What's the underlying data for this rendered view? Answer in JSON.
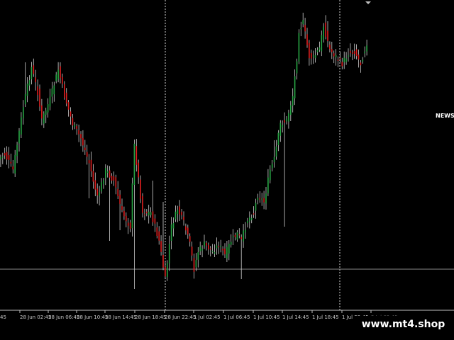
{
  "overlay": {
    "news_label": "NEWS",
    "brand_text": "www.mt4.shop"
  },
  "colors": {
    "background": "#000000",
    "bull_candle": "#28a745",
    "bear_candle": "#e02020",
    "wick": "#d0d0d0",
    "grid_separator": "#cfcfcf",
    "price_line": "#8a8a8a",
    "axis": "#bfbfbf",
    "label": "#c8c8c8"
  },
  "chart_data": {
    "type": "candlestick",
    "title": "",
    "xlabel": "",
    "ylabel": "",
    "x_tick_labels": [
      "28 Jun 02:45",
      "28 Jun 06:45",
      "28 Jun 10:45",
      "28 Jun 14:45",
      "28 Jun 18:45",
      "28 Jun 22:45",
      "1 Jul 02:45",
      "1 Jul 06:45",
      "1 Jul 10:45",
      "1 Jul 14:45",
      "1 Jul 18:45",
      "1 Jul 22:45",
      "2 Jul 02:45"
    ],
    "x_partial_left_label": "45",
    "dim_tick_label": "2 Jul 02:45",
    "session_separators_after": [
      "28 Jun 22:45",
      "1 Jul 22:45"
    ],
    "price_line_level": 60,
    "ylim": [
      0,
      440
    ],
    "price_path": [
      {
        "i": 0,
        "v": 225
      },
      {
        "i": 3,
        "v": 218
      },
      {
        "i": 7,
        "v": 240
      },
      {
        "i": 12,
        "v": 150
      },
      {
        "i": 16,
        "v": 95
      },
      {
        "i": 19,
        "v": 130
      },
      {
        "i": 21,
        "v": 170
      },
      {
        "i": 25,
        "v": 140
      },
      {
        "i": 29,
        "v": 98
      },
      {
        "i": 32,
        "v": 135
      },
      {
        "i": 36,
        "v": 175
      },
      {
        "i": 40,
        "v": 195
      },
      {
        "i": 44,
        "v": 230
      },
      {
        "i": 48,
        "v": 280
      },
      {
        "i": 52,
        "v": 240
      },
      {
        "i": 56,
        "v": 255
      },
      {
        "i": 60,
        "v": 300
      },
      {
        "i": 64,
        "v": 320
      },
      {
        "i": 66,
        "v": 205
      },
      {
        "i": 70,
        "v": 300
      },
      {
        "i": 74,
        "v": 300
      },
      {
        "i": 78,
        "v": 340
      },
      {
        "i": 81,
        "v": 395
      },
      {
        "i": 84,
        "v": 320
      },
      {
        "i": 87,
        "v": 295
      },
      {
        "i": 90,
        "v": 315
      },
      {
        "i": 93,
        "v": 345
      },
      {
        "i": 95,
        "v": 380
      },
      {
        "i": 97,
        "v": 355
      },
      {
        "i": 100,
        "v": 345
      },
      {
        "i": 104,
        "v": 355
      },
      {
        "i": 107,
        "v": 345
      },
      {
        "i": 110,
        "v": 360
      },
      {
        "i": 113,
        "v": 340
      },
      {
        "i": 116,
        "v": 330
      },
      {
        "i": 118,
        "v": 340
      },
      {
        "i": 121,
        "v": 310
      },
      {
        "i": 124,
        "v": 300
      },
      {
        "i": 126,
        "v": 275
      },
      {
        "i": 129,
        "v": 285
      },
      {
        "i": 132,
        "v": 240
      },
      {
        "i": 134,
        "v": 225
      },
      {
        "i": 137,
        "v": 175
      },
      {
        "i": 140,
        "v": 170
      },
      {
        "i": 143,
        "v": 135
      },
      {
        "i": 145,
        "v": 82
      },
      {
        "i": 146,
        "v": 42
      },
      {
        "i": 148,
        "v": 32
      },
      {
        "i": 151,
        "v": 80
      },
      {
        "i": 153,
        "v": 82
      },
      {
        "i": 156,
        "v": 68
      },
      {
        "i": 158,
        "v": 36
      },
      {
        "i": 161,
        "v": 70
      },
      {
        "i": 164,
        "v": 80
      },
      {
        "i": 167,
        "v": 90
      },
      {
        "i": 170,
        "v": 75
      },
      {
        "i": 173,
        "v": 72
      },
      {
        "i": 176,
        "v": 90
      },
      {
        "i": 179,
        "v": 60
      }
    ],
    "wick_spikes": [
      {
        "i": 13,
        "high": 88
      },
      {
        "i": 23,
        "high": 155
      },
      {
        "i": 35,
        "high": 210
      },
      {
        "i": 44,
        "low": 280
      },
      {
        "i": 49,
        "low": 290
      },
      {
        "i": 54,
        "low": 340
      },
      {
        "i": 59,
        "low": 325
      },
      {
        "i": 66,
        "low": 408
      },
      {
        "i": 75,
        "high": 255
      },
      {
        "i": 80,
        "high": 285
      },
      {
        "i": 118,
        "low": 394
      },
      {
        "i": 134,
        "high": 198
      },
      {
        "i": 139,
        "low": 320
      },
      {
        "i": 148,
        "high": 26
      },
      {
        "i": 160,
        "high": 30
      },
      {
        "i": 179,
        "high": 56
      }
    ]
  }
}
